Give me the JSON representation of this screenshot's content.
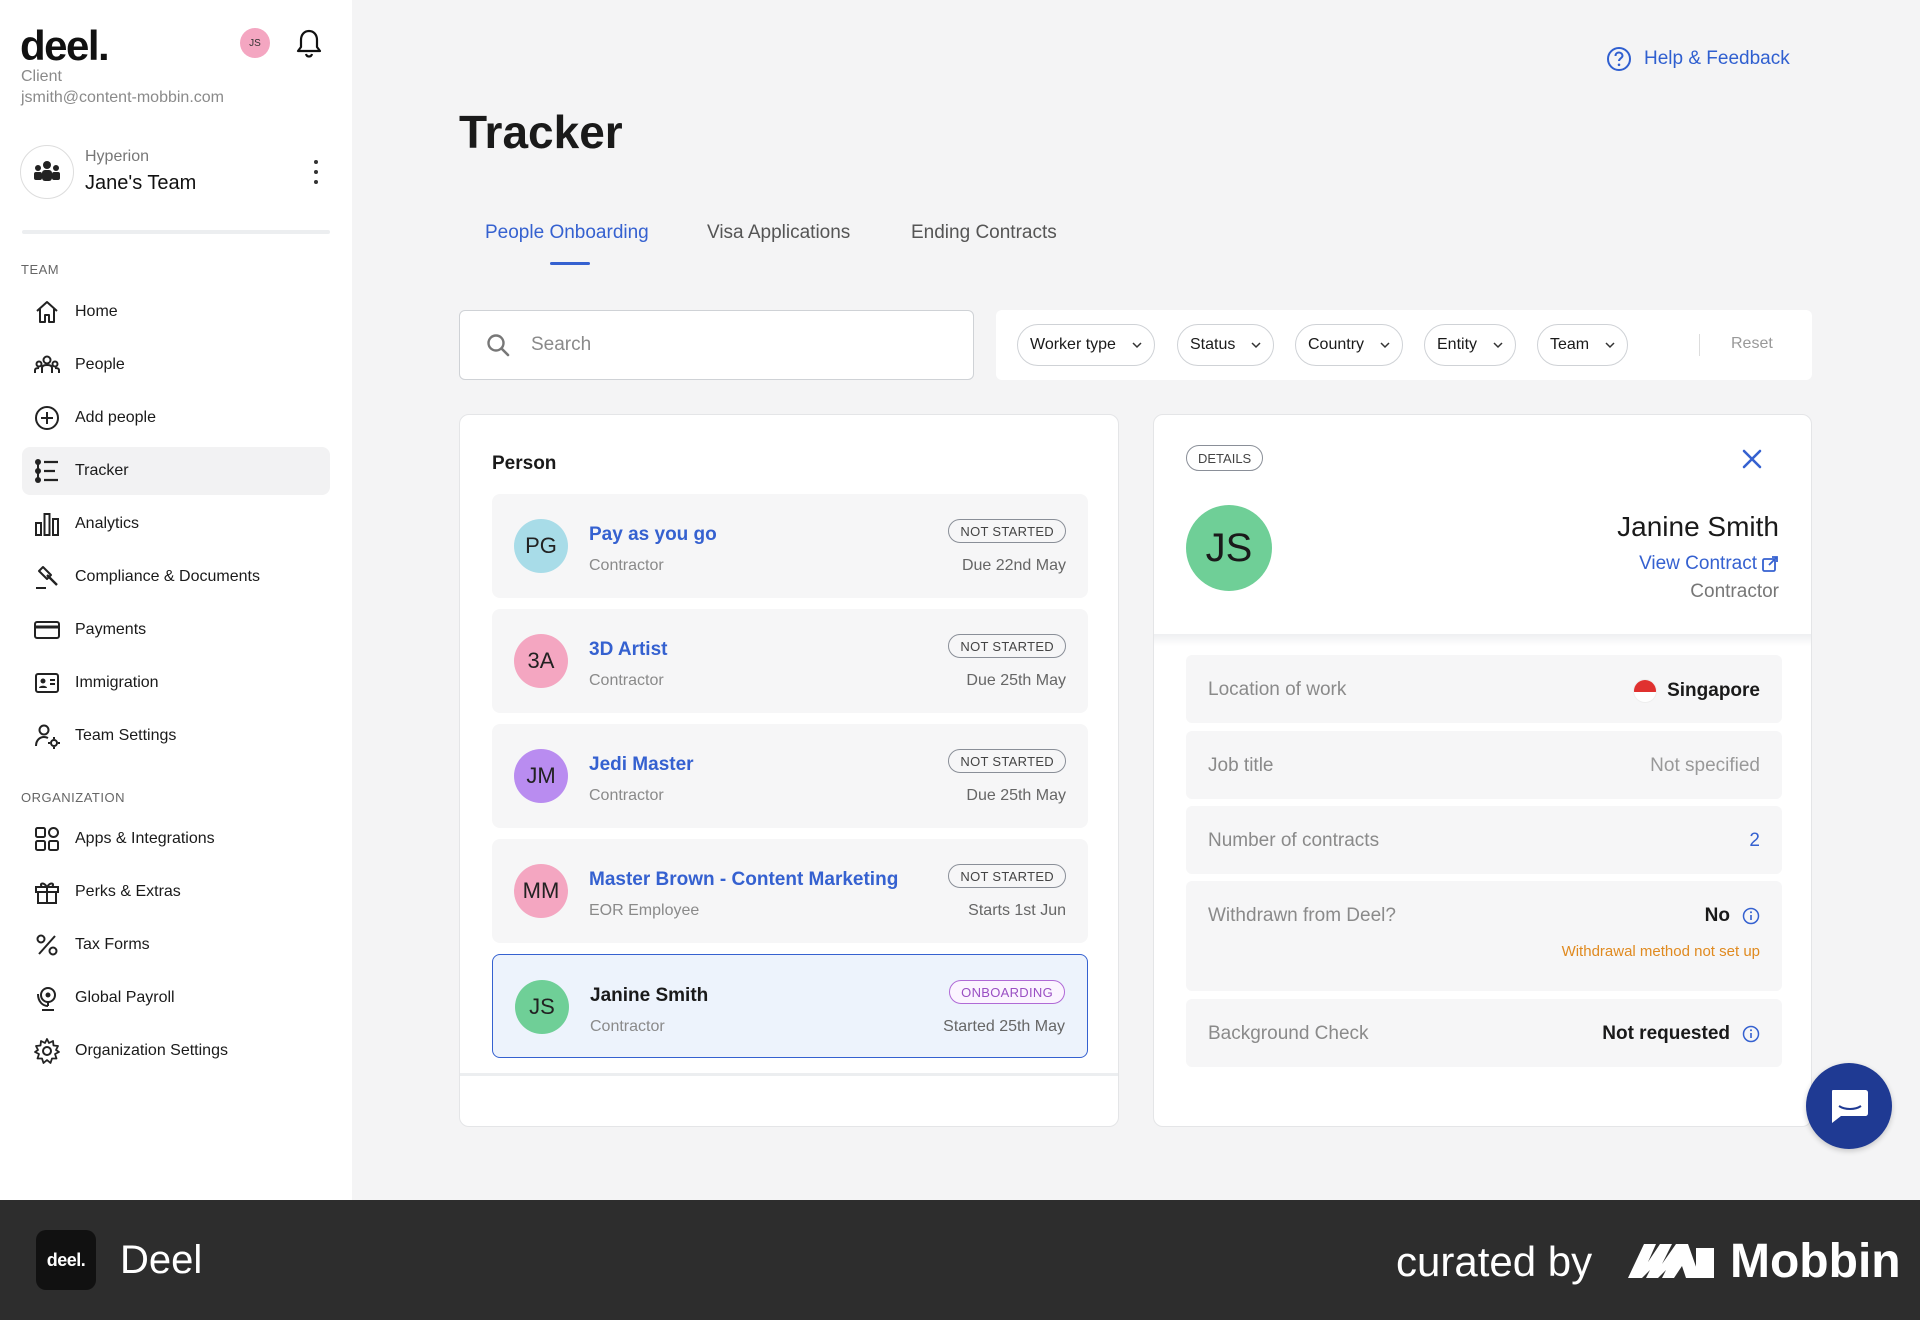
{
  "account": {
    "logo": "deel.",
    "avatar_initials": "JS",
    "role": "Client",
    "email": "jsmith@content-mobbin.com"
  },
  "team": {
    "org": "Hyperion",
    "name": "Jane's Team"
  },
  "sidebar": {
    "team_section_label": "TEAM",
    "org_section_label": "ORGANIZATION",
    "team_items": [
      {
        "label": "Home",
        "icon": "home-icon"
      },
      {
        "label": "People",
        "icon": "people-icon"
      },
      {
        "label": "Add people",
        "icon": "add-circle-icon"
      },
      {
        "label": "Tracker",
        "icon": "tracker-icon",
        "active": true
      },
      {
        "label": "Analytics",
        "icon": "bar-chart-icon"
      },
      {
        "label": "Compliance & Documents",
        "icon": "gavel-icon"
      },
      {
        "label": "Payments",
        "icon": "credit-card-icon"
      },
      {
        "label": "Immigration",
        "icon": "id-card-icon"
      },
      {
        "label": "Team Settings",
        "icon": "user-settings-icon"
      }
    ],
    "org_items": [
      {
        "label": "Apps & Integrations",
        "icon": "apps-grid-icon"
      },
      {
        "label": "Perks & Extras",
        "icon": "gift-icon"
      },
      {
        "label": "Tax Forms",
        "icon": "percent-icon"
      },
      {
        "label": "Global Payroll",
        "icon": "location-pin-icon"
      },
      {
        "label": "Organization Settings",
        "icon": "gear-icon"
      }
    ]
  },
  "header": {
    "help_label": "Help & Feedback",
    "title": "Tracker"
  },
  "tabs": [
    {
      "label": "People Onboarding",
      "active": true
    },
    {
      "label": "Visa Applications"
    },
    {
      "label": "Ending Contracts"
    }
  ],
  "search": {
    "placeholder": "Search",
    "value": ""
  },
  "filters": {
    "chips": [
      "Worker type",
      "Status",
      "Country",
      "Entity",
      "Team"
    ],
    "reset_label": "Reset"
  },
  "people_list": {
    "heading": "Person",
    "rows": [
      {
        "initials": "PG",
        "avatar_color": "#a8dce8",
        "name": "Pay as you go",
        "type": "Contractor",
        "status": "NOT STARTED",
        "date": "Due 22nd May"
      },
      {
        "initials": "3A",
        "avatar_color": "#f4a6c1",
        "name": "3D Artist",
        "type": "Contractor",
        "status": "NOT STARTED",
        "date": "Due 25th May"
      },
      {
        "initials": "JM",
        "avatar_color": "#b98cf0",
        "name": "Jedi Master",
        "type": "Contractor",
        "status": "NOT STARTED",
        "date": "Due 25th May"
      },
      {
        "initials": "MM",
        "avatar_color": "#f4a6c1",
        "name": "Master Brown - Content Marketing",
        "type": "EOR Employee",
        "status": "NOT STARTED",
        "date": "Starts 1st Jun"
      },
      {
        "initials": "JS",
        "avatar_color": "#6fcf97",
        "name": "Janine Smith",
        "type": "Contractor",
        "status": "ONBOARDING",
        "date": "Started 25th May",
        "selected": true
      }
    ]
  },
  "details": {
    "badge": "DETAILS",
    "initials": "JS",
    "name": "Janine Smith",
    "view_contract": "View Contract",
    "role": "Contractor",
    "fields": {
      "location_label": "Location of work",
      "location_value": "Singapore",
      "job_label": "Job title",
      "job_value": "Not specified",
      "contracts_label": "Number of contracts",
      "contracts_value": "2",
      "withdrawn_label": "Withdrawn from Deel?",
      "withdrawn_value": "No",
      "withdrawn_warning": "Withdrawal method not set up",
      "background_label": "Background Check",
      "background_value": "Not requested"
    }
  },
  "footer": {
    "app_logo": "deel.",
    "app_name": "Deel",
    "curated": "curated by",
    "brand": "Mobbin"
  }
}
